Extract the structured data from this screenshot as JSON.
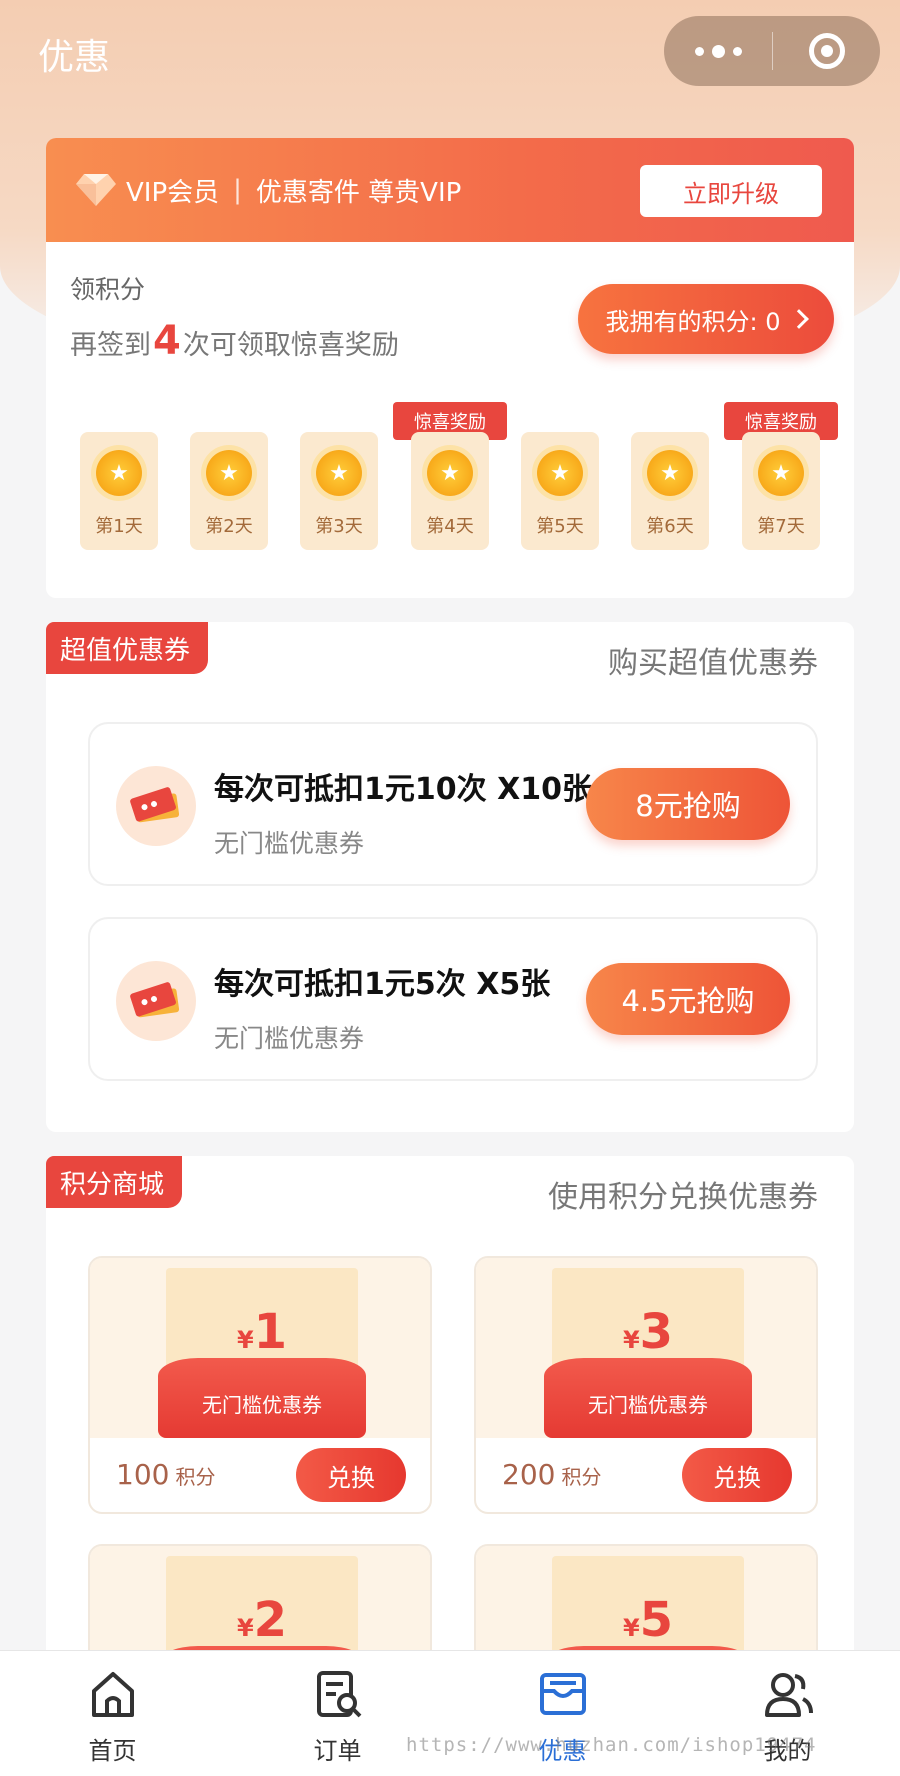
{
  "nav": {
    "title": "优惠"
  },
  "vip": {
    "label": "VIP会员",
    "separator": "|",
    "desc": "优惠寄件 尊贵VIP",
    "upgrade_btn": "立即升级"
  },
  "signin": {
    "title": "领积分",
    "sub_prefix": "再签到",
    "sub_count": "4",
    "sub_suffix": "次可领取惊喜奖励",
    "points_btn": "我拥有的积分: 0",
    "days": [
      "第1天",
      "第2天",
      "第3天",
      "第4天",
      "第5天",
      "第6天",
      "第7天"
    ],
    "surprise_tag": "惊喜奖励"
  },
  "coupons_section": {
    "tag": "超值优惠券",
    "hint": "购买超值优惠券",
    "items": [
      {
        "title": "每次可抵扣1元10次 X10张",
        "sub": "无门槛优惠券",
        "btn": "8元抢购"
      },
      {
        "title": "每次可抵扣1元5次 X5张",
        "sub": "无门槛优惠券",
        "btn": "4.5元抢购"
      }
    ]
  },
  "mall_section": {
    "tag": "积分商城",
    "hint": "使用积分兑换优惠券",
    "items": [
      {
        "yen": "¥",
        "amount": "1",
        "label": "无门槛优惠券",
        "points": "100",
        "unit": "积分",
        "btn": "兑换"
      },
      {
        "yen": "¥",
        "amount": "3",
        "label": "无门槛优惠券",
        "points": "200",
        "unit": "积分",
        "btn": "兑换"
      },
      {
        "yen": "¥",
        "amount": "2"
      },
      {
        "yen": "¥",
        "amount": "5"
      }
    ]
  },
  "tabbar": {
    "items": [
      {
        "label": "首页",
        "icon": "home-icon"
      },
      {
        "label": "订单",
        "icon": "order-search-icon"
      },
      {
        "label": "优惠",
        "icon": "coupon-box-icon"
      },
      {
        "label": "我的",
        "icon": "user-group-icon"
      }
    ],
    "active": "优惠"
  },
  "watermark": "https://www.huzhan.com/ishop19474"
}
